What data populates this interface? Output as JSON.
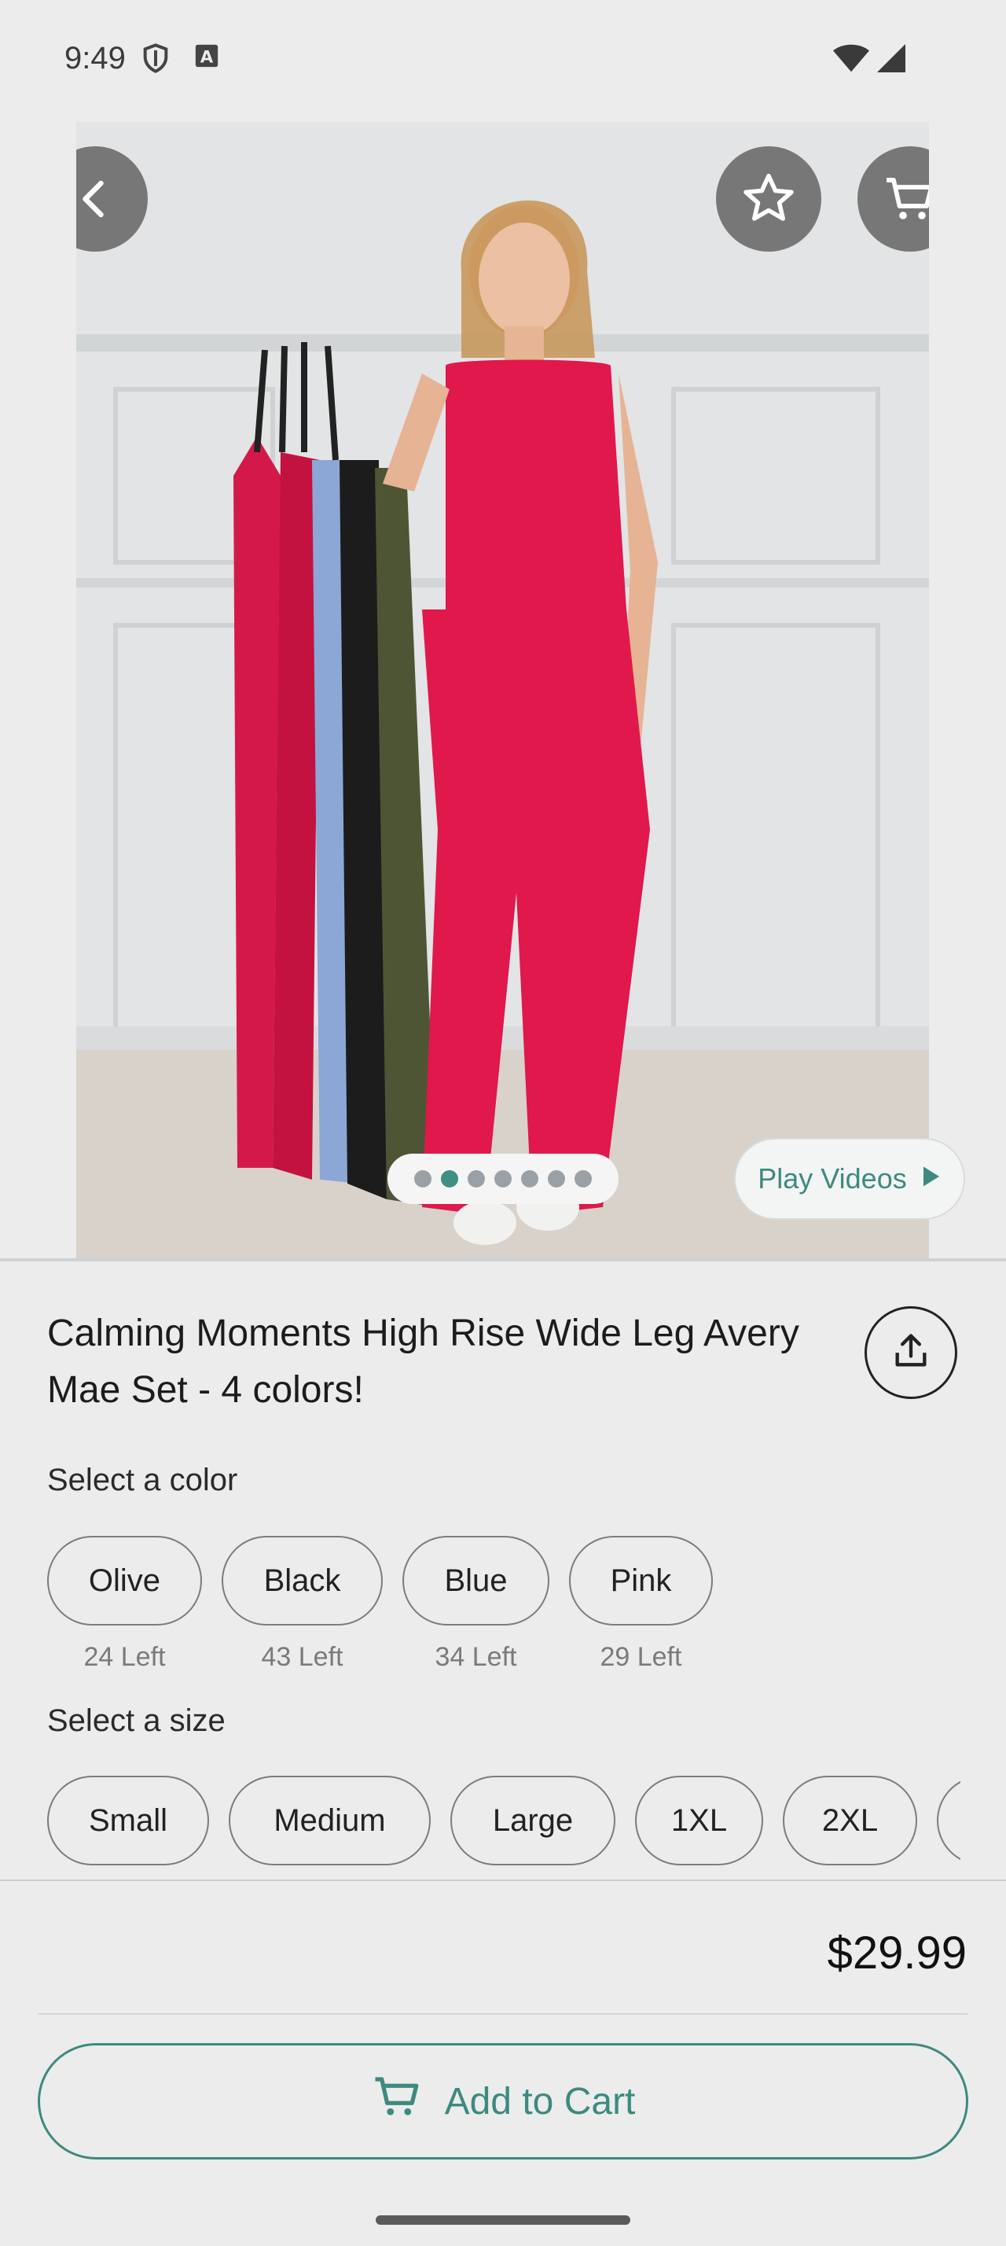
{
  "status_bar": {
    "time": "9:49",
    "icons": [
      "shield-icon",
      "text-a-icon",
      "wifi-icon",
      "cellular-signal-icon"
    ]
  },
  "hero": {
    "image_description": "model-photo",
    "pager": {
      "count": 7,
      "active_index": 1
    },
    "play_videos_label": "Play Videos",
    "top_buttons": [
      "back-icon",
      "star-icon",
      "cart-icon"
    ]
  },
  "product": {
    "title": "Calming Moments High Rise Wide Leg Avery Mae Set - 4 colors!",
    "color_label": "Select a color",
    "colors": [
      {
        "name": "Olive",
        "left": "24 Left"
      },
      {
        "name": "Black",
        "left": "43 Left"
      },
      {
        "name": "Blue",
        "left": "34 Left"
      },
      {
        "name": "Pink",
        "left": "29 Left"
      }
    ],
    "size_label": "Select a size",
    "sizes": [
      "Small",
      "Medium",
      "Large",
      "1XL",
      "2XL"
    ],
    "price": "$29.99"
  },
  "actions": {
    "add_to_cart": "Add to Cart"
  },
  "colors": {
    "accent": "#3d8a7f",
    "background": "#ececec"
  }
}
